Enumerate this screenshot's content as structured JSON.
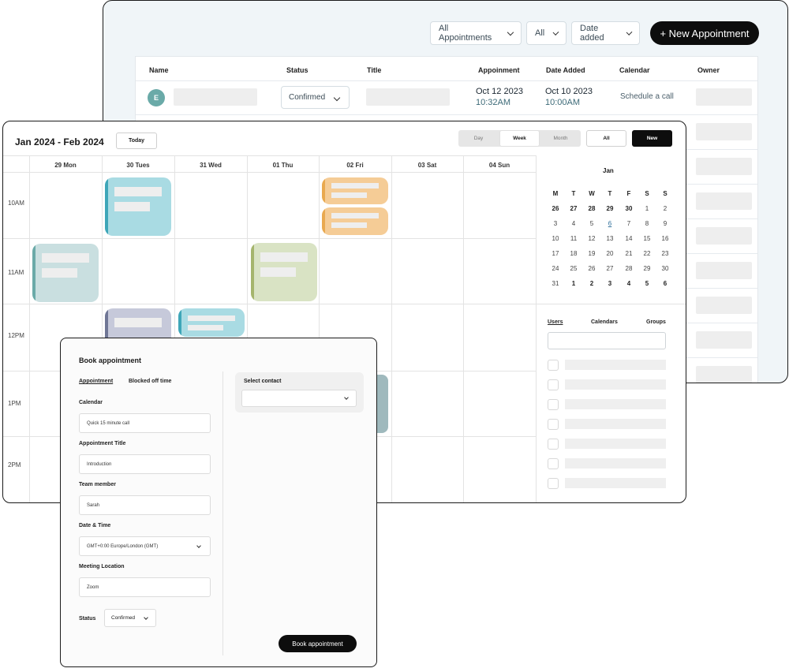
{
  "list_view": {
    "filters": [
      {
        "label": "All Appointments"
      },
      {
        "label": "All"
      },
      {
        "label": "Date added"
      }
    ],
    "new_button": "+ New Appointment",
    "columns": [
      "Name",
      "Status",
      "Title",
      "Appoinment",
      "Date Added",
      "Calendar",
      "Owner"
    ],
    "first_row": {
      "avatar": "E",
      "status": "Confirmed",
      "appointment_date": "Oct 12 2023",
      "appointment_time": "10:32AM",
      "added_date": "Oct 10 2023",
      "added_time": "10:00AM",
      "calendar": "Schedule a call"
    }
  },
  "calendar_view": {
    "range": "Jan 2024 - Feb 2024",
    "today": "Today",
    "view_tabs": [
      "Day",
      "Week",
      "Month"
    ],
    "active_view": "Week",
    "all_button": "All",
    "new_button": "New",
    "days": [
      "29 Mon",
      "30 Tues",
      "31 Wed",
      "01 Thu",
      "02 Fri",
      "03 Sat",
      "04 Sun"
    ],
    "times": [
      "10AM",
      "11AM",
      "12PM",
      "1PM",
      "2PM"
    ],
    "event_colors": {
      "teal": "#a9dbe3",
      "orange": "#f5cc96",
      "sage": "#c9dfe0",
      "olive": "#d9e3c4",
      "lavender": "#c6c9da"
    },
    "mini_month": {
      "title": "Jan",
      "weekdays": [
        "M",
        "T",
        "W",
        "T",
        "F",
        "S",
        "S"
      ],
      "weeks": [
        [
          "26",
          "27",
          "28",
          "29",
          "30",
          "1",
          "2"
        ],
        [
          "3",
          "4",
          "5",
          "6",
          "7",
          "8",
          "9"
        ],
        [
          "10",
          "11",
          "12",
          "13",
          "14",
          "15",
          "16"
        ],
        [
          "17",
          "18",
          "19",
          "20",
          "21",
          "22",
          "23"
        ],
        [
          "24",
          "25",
          "26",
          "27",
          "28",
          "29",
          "30"
        ],
        [
          "31",
          "1",
          "2",
          "3",
          "4",
          "5",
          "6"
        ]
      ],
      "highlighted_day": "6"
    },
    "side_tabs": [
      "Users",
      "Calendars",
      "Groups"
    ]
  },
  "booking": {
    "title": "Book appointment",
    "tabs": [
      "Appointment",
      "Blocked off time"
    ],
    "fields": [
      {
        "label": "Calendar",
        "value": "Quick 15 minute call"
      },
      {
        "label": "Appointment Title",
        "value": "Introduction"
      },
      {
        "label": "Team member",
        "value": "Sarah"
      },
      {
        "label": "Date & Time",
        "value": "GMT+0:00 Europe/London (GMT)"
      },
      {
        "label": "Meeting Location",
        "value": "Zoom"
      }
    ],
    "status_label": "Status",
    "status_value": "Confirmed",
    "contact_label": "Select contact",
    "submit": "Book appointment"
  }
}
